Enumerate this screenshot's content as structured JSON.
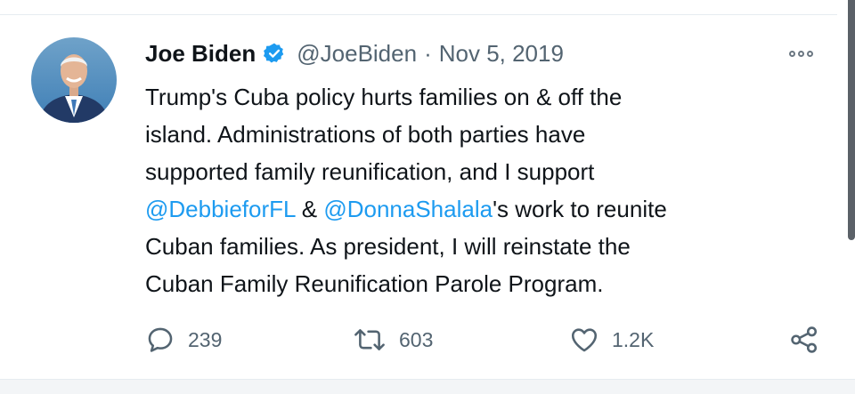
{
  "tweet": {
    "author_name": "Joe Biden",
    "handle": "@JoeBiden",
    "separator": "·",
    "date": "Nov 5, 2019",
    "text_line1": "Trump's Cuba policy hurts families on & off the",
    "text_line2": "island. Administrations of both parties have",
    "text_line3": "supported family reunification, and I support",
    "mention1": "@DebbieforFL",
    "amp": " & ",
    "mention2": "@DonnaShalala",
    "text_line4_rest": "'s work to reunite",
    "text_line5": "Cuban families. As president, I will reinstate the",
    "text_line6": "Cuban Family Reunification Parole Program."
  },
  "actions": {
    "reply_count": "239",
    "retweet_count": "603",
    "like_count": "1.2K"
  },
  "icons": {
    "verified": "verified-badge-icon",
    "more": "more-options-icon",
    "reply": "reply-icon",
    "retweet": "retweet-icon",
    "like": "heart-icon",
    "share": "share-icon"
  },
  "colors": {
    "link": "#1d9bf0",
    "verified": "#1d9bf0",
    "secondary_text": "#536471"
  }
}
